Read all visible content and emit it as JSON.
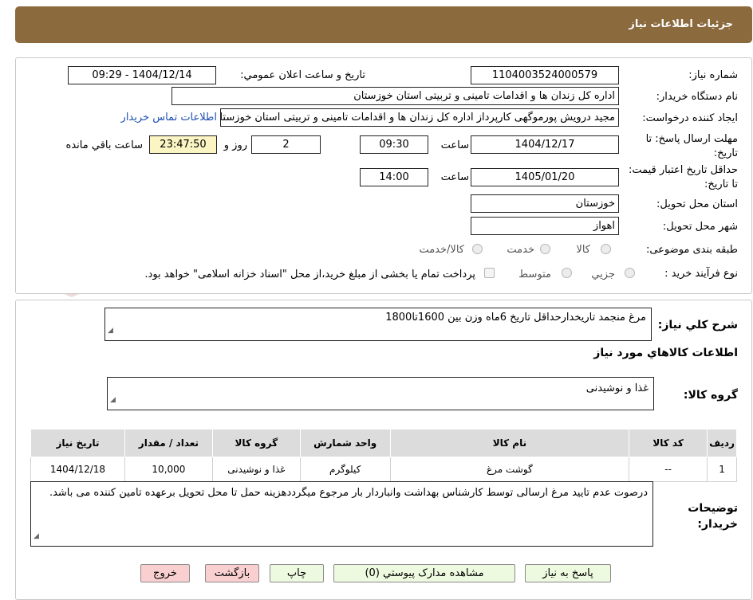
{
  "header": {
    "title": "جزئیات اطلاعات نیاز"
  },
  "labels": {
    "need_number": "شماره نياز:",
    "announce_datetime": "تاريخ و ساعت اعلان عمومي:",
    "buyer_org": "نام دستگاه خريدار:",
    "requester": "ايجاد کننده درخواست:",
    "deadline": "مهلت ارسال پاسخ: تا تاريخ:",
    "validity": "حداقل تاريخ اعتبار قيمت: تا تاريخ:",
    "province": "استان محل تحويل:",
    "city": "شهر محل تحويل:",
    "category": "طبقه بندی موضوعی:",
    "process": "نوع فرآيند خريد :",
    "time": "ساعت",
    "days_and": "روز و",
    "remaining": "ساعت باقي مانده"
  },
  "values": {
    "need_number": "1104003524000579",
    "announce_datetime": "1404/12/14 - 09:29",
    "buyer_org": "اداره کل زندان ها و اقدامات تامینی و تربیتی استان خوزستان",
    "requester": "مجید درویش پورموگهی کارپرداز اداره کل زندان ها و اقدامات تامینی و تربیتی استان خوزستان",
    "contact_link": "اطلاعات تماس خريدار",
    "deadline_date": "1404/12/17",
    "deadline_time": "09:30",
    "days": "2",
    "countdown": "23:47:50",
    "validity_date": "1405/01/20",
    "validity_time": "14:00",
    "province": "خوزستان",
    "city": "اهواز"
  },
  "category_options": [
    "کالا",
    "خدمت",
    "کالا/خدمت"
  ],
  "process_options": [
    "جزيي",
    "متوسط"
  ],
  "payment_note": "پرداخت تمام يا بخشی از مبلغ خريد،از محل \"اسناد خزانه اسلامی\" خواهد بود.",
  "summary": {
    "label": "شرح کلي نياز:",
    "text": "مرغ منجمد تاریخدارحداقل تاریخ 6ماه وزن بین 1600تا1800"
  },
  "goods_info_title": "اطلاعات کالاهاي مورد نياز",
  "goods_group": {
    "label": "گروه کالا:",
    "value": "غذا و نوشیدنی"
  },
  "table": {
    "headers": [
      "رديف",
      "کد کالا",
      "نام کالا",
      "واحد شمارش",
      "گروه کالا",
      "تعداد / مقدار",
      "تاريخ نياز"
    ],
    "rows": [
      [
        "1",
        "--",
        "گوشت مرغ",
        "کیلوگرم",
        "غذا و نوشیدنی",
        "10,000",
        "1404/12/18"
      ]
    ]
  },
  "buyer_notes": {
    "label": "توضيحات خريدار:",
    "text": "درصوت عدم تایید مرغ ارسالی توسط کارشناس بهداشت وانباردار بار مرجوع میگرددهزینه حمل تا محل تحویل برعهده تامین کننده می باشد."
  },
  "buttons": {
    "reply": "پاسخ به نياز",
    "view_docs": "مشاهده مدارک پيوستي (0)",
    "print": "چاپ",
    "back": "بازگشت",
    "exit": "خروج"
  },
  "watermark": "AriaTender.neT",
  "colors": {
    "header": "#8b6a3e",
    "link": "#1e4fb5",
    "countdown_bg": "#fbf5c4",
    "button_green": "#eefadf",
    "button_red": "#f9cfcf"
  }
}
